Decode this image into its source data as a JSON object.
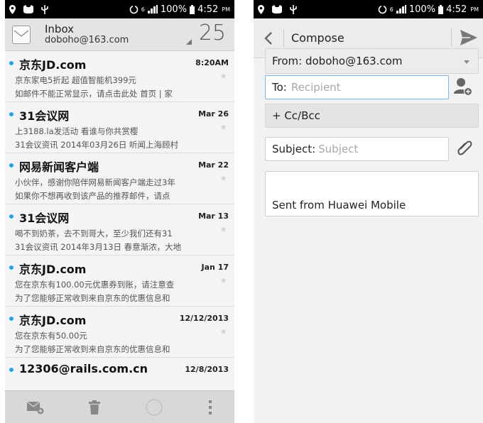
{
  "status_left": {
    "time": "4:52",
    "ampm": "PM",
    "battery": "100%",
    "network": "6"
  },
  "status_right": {
    "time": "4:52",
    "ampm": "PM",
    "battery": "100%",
    "network": "6"
  },
  "inbox": {
    "title": "Inbox",
    "account": "doboho@163.com",
    "unread_count": "25"
  },
  "mails": [
    {
      "sender": "京东JD.com",
      "date": "8:20AM",
      "line1": "京东家电5折起 超值智能机399元",
      "line2": "如邮件不能正常显示，请点击此处 首页 | 家"
    },
    {
      "sender": "31会议网",
      "date": "Mar 26",
      "line1": "上3188.la发活动 看谁与你共赏樱",
      "line2": "31会议资讯 2014年03月26日 听闻上海顾村"
    },
    {
      "sender": "网易新闻客户端",
      "date": "Mar 22",
      "line1": "小伙伴，感谢你陪伴网易新闻客户端走过3年",
      "line2": "如果你不想再收到该产品的推荐邮件，请点"
    },
    {
      "sender": "31会议网",
      "date": "Mar 13",
      "line1": "喝不到奶茶，去不到哥大，至少我们还有31",
      "line2": "31会议资讯 2014年3月13日 春意渐浓，大地"
    },
    {
      "sender": "京东JD.com",
      "date": "Jan 17",
      "line1": "您在京东有100.00元优惠券到账，请注意查",
      "line2": "为了您能够正常收到来自京东的优惠信息和"
    },
    {
      "sender": "京东JD.com",
      "date": "12/12/2013",
      "line1": "您在京东有50.00元",
      "line2": "为了您能够正常收到来自京东的优惠信息和"
    },
    {
      "sender": "12306@rails.com.cn",
      "date": "12/8/2013",
      "line1": "",
      "line2": ""
    }
  ],
  "compose": {
    "title": "Compose",
    "from": "From: doboho@163.com",
    "to_label": "To:",
    "to_placeholder": "Recipient",
    "cc_bcc": "+ Cc/Bcc",
    "subject_label": "Subject:",
    "subject_placeholder": "Subject",
    "signature": "Sent from Huawei Mobile"
  },
  "icons": [
    "location-icon",
    "cat-icon",
    "usb-icon",
    "sync-icon",
    "signal-icon",
    "battery-icon",
    "compose-mail-icon",
    "trash-icon",
    "refresh-icon",
    "overflow-menu-icon",
    "back-icon",
    "send-icon",
    "add-contact-icon",
    "attach-icon"
  ],
  "colors": {
    "unread_dot": "#2aa1e0",
    "to_border": "#7ab6e8"
  }
}
